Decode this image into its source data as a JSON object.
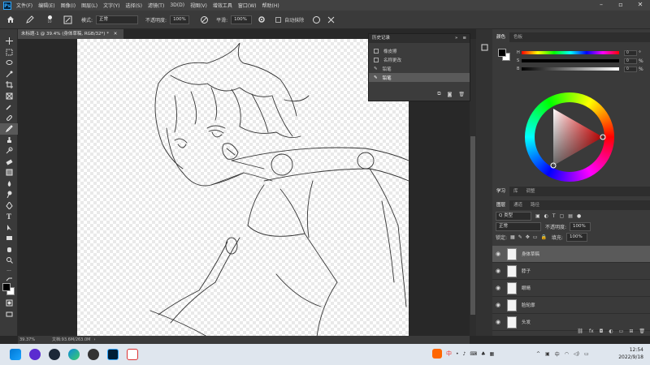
{
  "menubar": {
    "logo": "Ps",
    "items": [
      "文件(F)",
      "编辑(E)",
      "图像(I)",
      "图层(L)",
      "文字(Y)",
      "选择(S)",
      "滤镜(T)",
      "3D(D)",
      "视图(V)",
      "增效工具",
      "窗口(W)",
      "帮助(H)"
    ]
  },
  "options": {
    "brush_size": "10",
    "mode_label": "模式:",
    "mode_value": "正常",
    "opacity_label": "不透明度:",
    "opacity_value": "100%",
    "smooth_label": "平滑:",
    "smooth_value": "100%",
    "auto_erase": "自动抹除"
  },
  "document": {
    "tab_title": "未标题-1 @ 39.4% (身体草稿, RGB/32*) *",
    "zoom": "39.37%",
    "doc_info": "文档:93.6M/263.0M"
  },
  "history": {
    "title": "历史记录",
    "items": [
      "橡皮擦",
      "名称更改",
      "铅笔",
      "铅笔"
    ]
  },
  "color": {
    "tabs": [
      "颜色",
      "色板"
    ],
    "sliders": [
      {
        "label": "H",
        "value": "0"
      },
      {
        "label": "S",
        "value": "0"
      },
      {
        "label": "B",
        "value": "0"
      }
    ],
    "units": [
      "°",
      "%",
      "%"
    ]
  },
  "learn_tabs": [
    "学习",
    "库",
    "调整"
  ],
  "layers": {
    "tabs": [
      "图层",
      "通道",
      "路径"
    ],
    "kind_label": "Q 类型",
    "blend_mode": "正常",
    "opacity_label": "不透明度:",
    "opacity_value": "100%",
    "lock_label": "锁定:",
    "fill_label": "填充:",
    "fill_value": "100%",
    "items": [
      "身体草稿",
      "脖子",
      "眼睛",
      "脸轮廓",
      "头发"
    ]
  },
  "taskbar": {
    "ime": "中",
    "time": "12:54",
    "date": "2022/9/18"
  }
}
